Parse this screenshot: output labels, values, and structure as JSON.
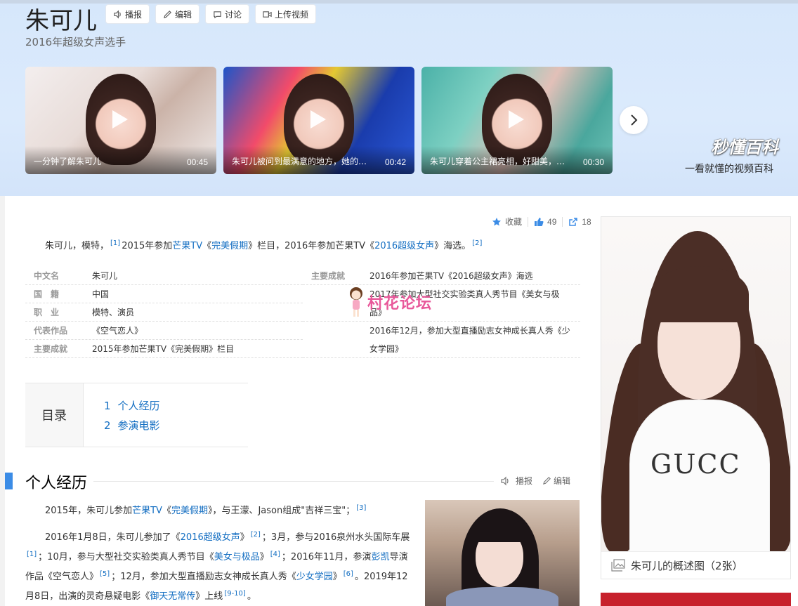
{
  "header": {
    "title": "朱可儿",
    "subtitle": "2016年超级女声选手",
    "actions": [
      {
        "label": "播报",
        "icon": "speaker-icon"
      },
      {
        "label": "编辑",
        "icon": "pencil-icon"
      },
      {
        "label": "讨论",
        "icon": "chat-bubble-icon"
      },
      {
        "label": "上传视频",
        "icon": "video-camera-icon"
      }
    ]
  },
  "videos": [
    {
      "title": "一分钟了解朱可儿",
      "duration": "00:45"
    },
    {
      "title": "朱可儿被问到最满意的地方，她的回...",
      "duration": "00:42"
    },
    {
      "title": "朱可儿穿着公主裙亮相，好甜美，不...",
      "duration": "00:30"
    }
  ],
  "brand": {
    "logo": "秒懂百科",
    "slogan": "一看就懂的视频百科"
  },
  "stats": {
    "favorite_label": "收藏",
    "likes": "49",
    "shares": "18"
  },
  "intro": {
    "t1": "朱可儿，模特，",
    "ref1": "[1]",
    "t2": "2015年参加",
    "link1": "芒果TV",
    "t3": "《",
    "link2": "完美假期",
    "t4": "》栏目，2016年参加芒果TV《",
    "link3": "2016超级女声",
    "t5": "》海选。",
    "ref2": "[2]"
  },
  "infobox": {
    "left": [
      {
        "key": "中文名",
        "value": "朱可儿"
      },
      {
        "key": "国　籍",
        "value": "中国"
      },
      {
        "key": "职　业",
        "value": "模特、演员"
      },
      {
        "key": "代表作品",
        "value": "《空气恋人》"
      },
      {
        "key": "主要成就",
        "value": "2015年参加芒果TV《完美假期》栏目"
      }
    ],
    "right": [
      {
        "key": "主要成就",
        "value": "2016年参加芒果TV《2016超级女声》海选"
      },
      {
        "key": "",
        "value": "2017年参加大型社交实验类真人秀节目《美女与极品》"
      },
      {
        "key": "",
        "value": "2016年12月，参加大型直播励志女神成长真人秀《少女学园》"
      }
    ]
  },
  "watermark": "村花论坛",
  "toc": {
    "label": "目录",
    "items": [
      {
        "num": "1",
        "label": "个人经历"
      },
      {
        "num": "2",
        "label": "参演电影"
      }
    ]
  },
  "section": {
    "title": "个人经历",
    "report_label": "播报",
    "edit_label": "编辑",
    "p1": {
      "a": "2015年，朱可儿参加",
      "l1": "芒果TV",
      "b": "《",
      "l2": "完美假期",
      "c": "》，与王濛、Jason组成\"吉祥三宝\"；",
      "ref": "[3]"
    },
    "p2": {
      "a": "2016年1月8日，朱可儿参加了《",
      "l1": "2016超级女声",
      "b": "》",
      "r1": "[2]",
      "c": "；3月，参与2016泉州水头国际车展",
      "r2": "[1]",
      "d": "；10月，参与大型社交实验类真人秀节目《",
      "l2": "美女与极品",
      "e": "》",
      "r3": "[4]",
      "f": "；2016年11月，参演",
      "l3": "彭凯",
      "g": "导演作品《空气恋人》",
      "r4": "[5]",
      "h": "；12月，参加大型直播励志女神成长真人秀《",
      "l4": "少女学园",
      "i": "》",
      "r5": "[6]",
      "j": "。2019年12月8日，出演的灵奇悬疑电影《",
      "l5": "御天无常传",
      "k": "》上线",
      "r6": "[9-10]",
      "l": "。"
    }
  },
  "album": {
    "caption": "朱可儿的概述图（2张）",
    "shirt_text": "GUCC"
  },
  "colors": {
    "accent": "#3b8ce6",
    "link": "#136ec2",
    "banner": "#d6e7fb",
    "watermark": "#e8589a"
  }
}
